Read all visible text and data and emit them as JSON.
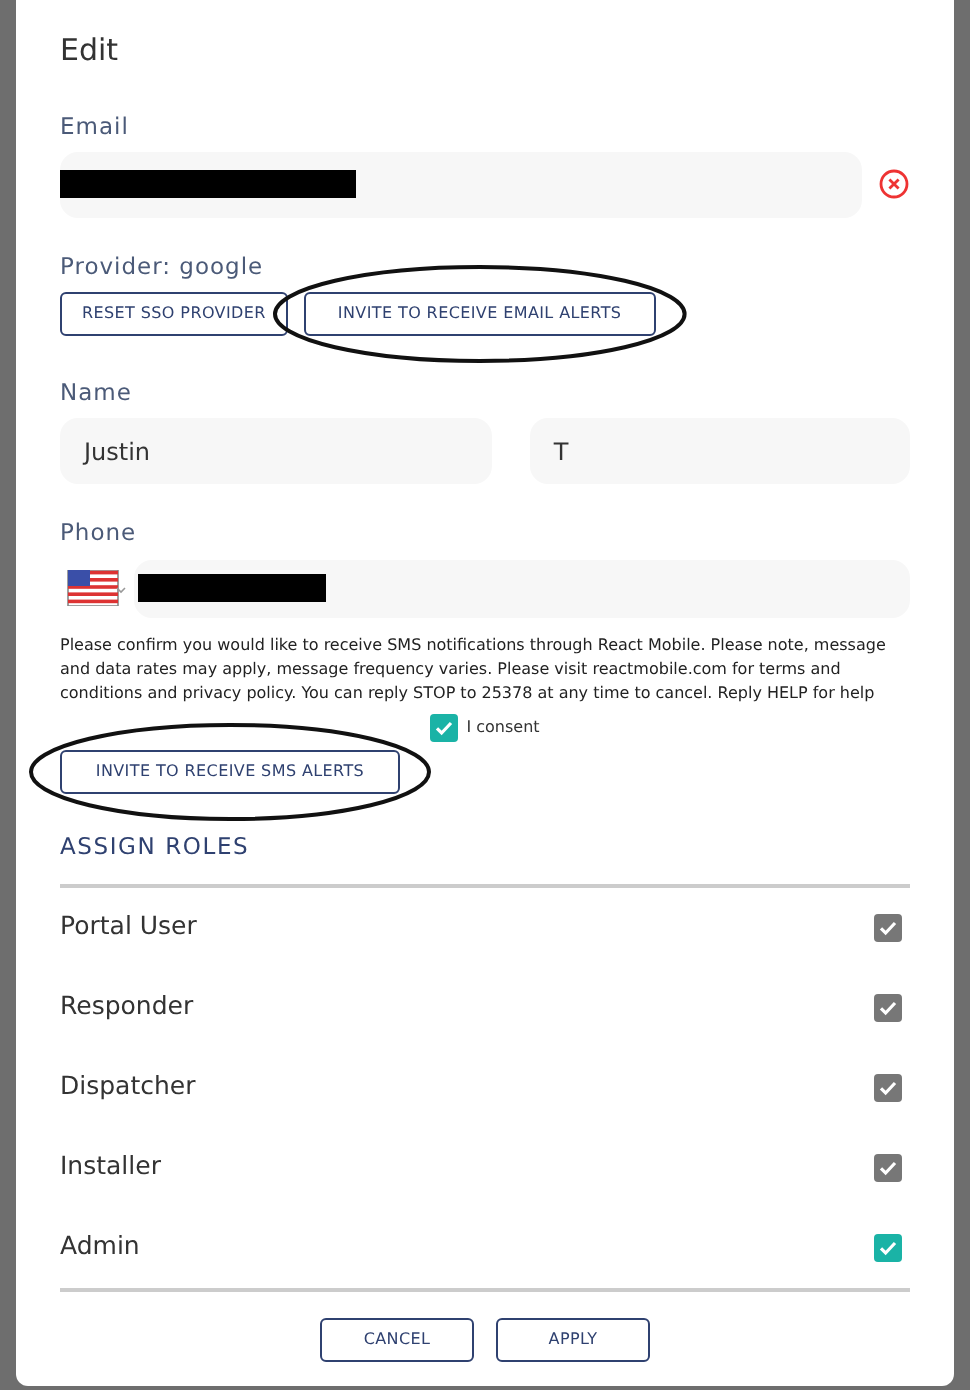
{
  "dialog": {
    "title": "Edit"
  },
  "email": {
    "label": "Email",
    "redacted": true
  },
  "provider": {
    "label": "Provider: google"
  },
  "provider_buttons": [
    {
      "label": "RESET SSO PROVIDER",
      "annotated": false
    },
    {
      "label": "INVITE TO RECEIVE EMAIL ALERTS",
      "annotated": true
    }
  ],
  "name": {
    "label": "Name",
    "first": "Justin",
    "last": "T"
  },
  "phone": {
    "label": "Phone",
    "redacted": true
  },
  "sms_notice": "Please confirm you would like to receive SMS notifications through React Mobile. Please note, message and data rates may apply, message frequency varies. Please visit reactmobile.com for terms and conditions and privacy policy. You can reply STOP to 25378 at any time to cancel. Reply HELP for help",
  "consent": {
    "label": "I consent",
    "checked": true
  },
  "sms_button": {
    "label": "INVITE TO RECEIVE SMS ALERTS",
    "annotated": true
  },
  "roles_heading": "ASSIGN ROLES",
  "roles": [
    {
      "name": "Portal User",
      "checked": true,
      "disabled": true
    },
    {
      "name": "Responder",
      "checked": true,
      "disabled": true
    },
    {
      "name": "Dispatcher",
      "checked": true,
      "disabled": true
    },
    {
      "name": "Installer",
      "checked": true,
      "disabled": true
    },
    {
      "name": "Admin",
      "checked": true,
      "disabled": false
    }
  ],
  "footer_buttons": [
    "CANCEL",
    "APPLY"
  ]
}
